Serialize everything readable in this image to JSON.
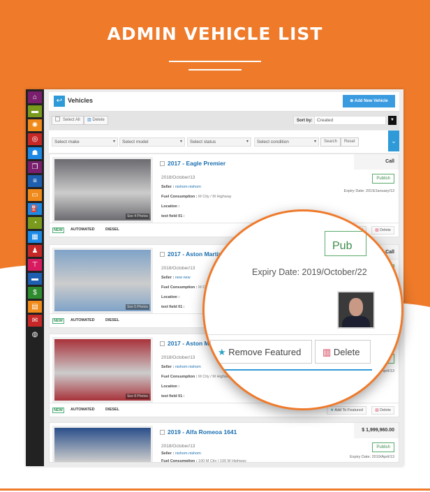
{
  "page_title": "ADMIN VEHICLE LIST",
  "colors": {
    "accent": "#ee7a2a",
    "primary": "#2e9ad8",
    "link": "#1a6fb0"
  },
  "sidebar": {
    "items": [
      {
        "icon": "home-icon",
        "color": "#7a1f6e",
        "glyph": "⌂"
      },
      {
        "icon": "car-icon",
        "color": "#7a9a1e",
        "glyph": "▬"
      },
      {
        "icon": "gear-icon",
        "color": "#f08a1a",
        "glyph": "✺"
      },
      {
        "icon": "steering-wheel-icon",
        "color": "#c62828",
        "glyph": "◎"
      },
      {
        "icon": "user-icon",
        "color": "#1e88e5",
        "glyph": "☗"
      },
      {
        "icon": "cube-icon",
        "color": "#7a1f6e",
        "glyph": "❒"
      },
      {
        "icon": "database-icon",
        "color": "#1e5fb0",
        "glyph": "≡"
      },
      {
        "icon": "vehicle-front-icon",
        "color": "#f08a1a",
        "glyph": "▭"
      },
      {
        "icon": "fuel-icon",
        "color": "#1e88e5",
        "glyph": "⛽"
      },
      {
        "icon": "speedometer-icon",
        "color": "#7a9a1e",
        "glyph": "◔"
      },
      {
        "icon": "calendar-icon",
        "color": "#1e88e5",
        "glyph": "▦"
      },
      {
        "icon": "gear-shift-icon",
        "color": "#c62828",
        "glyph": "♟"
      },
      {
        "icon": "piston-icon",
        "color": "#d81b60",
        "glyph": "⊤"
      },
      {
        "icon": "car-side-icon",
        "color": "#1e5fb0",
        "glyph": "▬"
      },
      {
        "icon": "money-icon",
        "color": "#2e8b2e",
        "glyph": "$"
      },
      {
        "icon": "report-icon",
        "color": "#f08a1a",
        "glyph": "▤"
      },
      {
        "icon": "inbox-icon",
        "color": "#c62828",
        "glyph": "✉"
      },
      {
        "icon": "globe-icon",
        "color": "#222222",
        "glyph": "◍"
      }
    ]
  },
  "header": {
    "title": "Vehicles",
    "add_button": "Add New Vehicle"
  },
  "toolbar": {
    "select_all": "Select All",
    "delete": "Delete",
    "sort_label": "Sort by:",
    "sort_value": "Created"
  },
  "filters": {
    "make": "Select make",
    "model": "Select model",
    "status": "Select status",
    "condition": "Select condition",
    "search": "Search",
    "reset": "Reset"
  },
  "labels": {
    "seller": "Seller :",
    "fuel": "Fuel Consumption :",
    "location": "Location :",
    "text_field": "text field 01 :",
    "publish": "Publish",
    "expiry_prefix": "Expiry Date:",
    "add_featured": "Add To Featured",
    "delete": "Delete"
  },
  "vehicles": [
    {
      "title": "2017 - Eagle Premier",
      "right": "Call",
      "date": "2018/October/13",
      "seller": "nishom nishom",
      "fuel": "M City / M Highway",
      "expiry": "2019/January/13",
      "photos": "See 4 Photos",
      "tags": [
        "NEW",
        "AUTOMATED",
        "DIESEL"
      ],
      "img": "#6b6b70"
    },
    {
      "title": "2017 - Aston Martin DB9",
      "right": "Call",
      "date": "2018/October/13",
      "seller": "new new",
      "fuel": "M City / M Highway",
      "expiry": "2019/April/13",
      "photos": "See 5 Photos",
      "tags": [
        "NEW",
        "AUTOMATED",
        "DIESEL"
      ],
      "img": "#7fa3c8"
    },
    {
      "title": "2017 - Aston Martin",
      "right": "Call",
      "date": "2018/October/13",
      "seller": "nishom nishom",
      "fuel": "M City / M Highway",
      "expiry": "2019/April/13",
      "photos": "See 8 Photos",
      "tags": [
        "NEW",
        "AUTOMATED",
        "DIESEL"
      ],
      "img": "#a8323a"
    },
    {
      "title": "2019 - Alfa Romeoa 1641",
      "right": "$ 1,999,960.00",
      "date": "2018/October/13",
      "seller": "nishom nishom",
      "fuel": "100 M City / 100 M Highway",
      "expiry": "2019/April/13",
      "photos": "",
      "tags": [],
      "img": "#2a4f8a"
    }
  ],
  "magnifier": {
    "publish": "Pub",
    "expiry": "Expiry Date: 2019/October/22",
    "remove_featured": "Remove Featured",
    "delete": "Delete"
  }
}
